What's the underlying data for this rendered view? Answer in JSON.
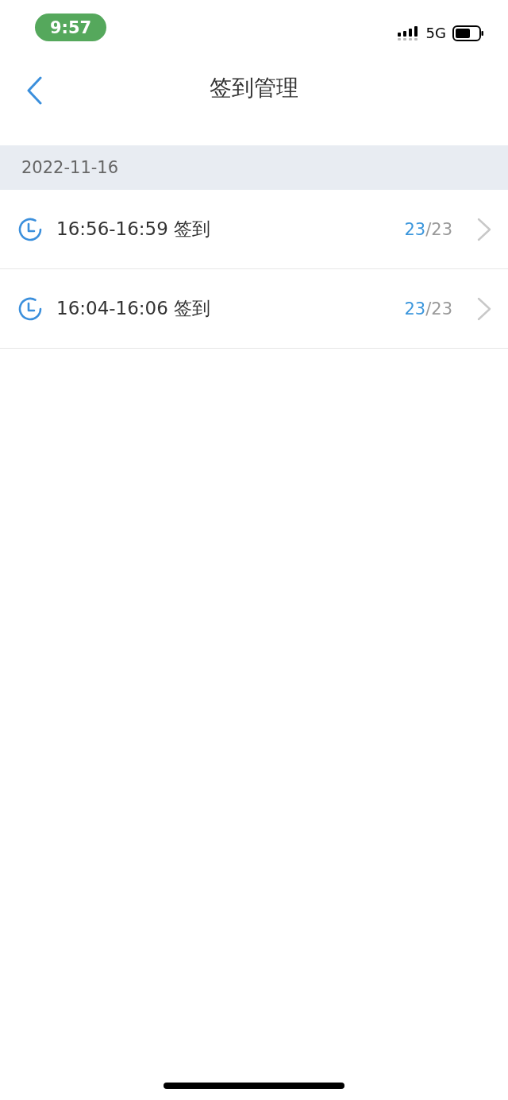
{
  "status_bar": {
    "time": "9:57",
    "network": "5G"
  },
  "nav": {
    "title": "签到管理"
  },
  "date_header": "2022-11-16",
  "sessions": [
    {
      "time": "16:56-16:59 签到",
      "signed": "23",
      "total": "/23"
    },
    {
      "time": "16:04-16:06 签到",
      "signed": "23",
      "total": "/23"
    }
  ]
}
